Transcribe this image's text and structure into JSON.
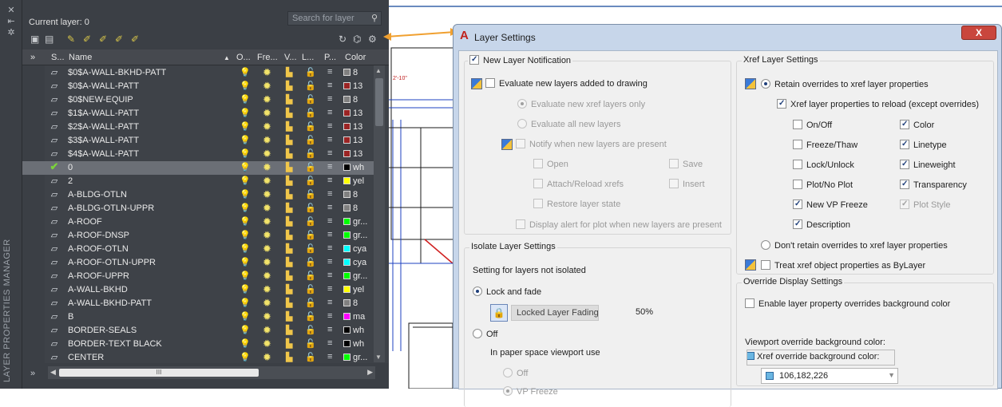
{
  "palette": {
    "vertical_title": "LAYER PROPERTIES MANAGER",
    "current_layer": "Current layer: 0",
    "search_placeholder": "Search for layer",
    "columns": {
      "status": "S...",
      "name": "Name",
      "on": "O...",
      "freeze": "Fre...",
      "vp": "V...",
      "lock": "L...",
      "plot": "P...",
      "color": "Color"
    },
    "layers": [
      {
        "name": "$0$A-WALL-BKHD-PATT",
        "color": "#808080",
        "color_name": "8",
        "current": false
      },
      {
        "name": "$0$A-WALL-PATT",
        "color": "#9b2424",
        "color_name": "13",
        "current": false
      },
      {
        "name": "$0$NEW-EQUIP",
        "color": "#808080",
        "color_name": "8",
        "current": false
      },
      {
        "name": "$1$A-WALL-PATT",
        "color": "#9b2424",
        "color_name": "13",
        "current": false
      },
      {
        "name": "$2$A-WALL-PATT",
        "color": "#9b2424",
        "color_name": "13",
        "current": false
      },
      {
        "name": "$3$A-WALL-PATT",
        "color": "#9b2424",
        "color_name": "13",
        "current": false
      },
      {
        "name": "$4$A-WALL-PATT",
        "color": "#9b2424",
        "color_name": "13",
        "current": false
      },
      {
        "name": "0",
        "color": "#000000",
        "color_name": "wh",
        "current": true
      },
      {
        "name": "2",
        "color": "#ffff00",
        "color_name": "yel",
        "current": false
      },
      {
        "name": "A-BLDG-OTLN",
        "color": "#808080",
        "color_name": "8",
        "current": false
      },
      {
        "name": "A-BLDG-OTLN-UPPR",
        "color": "#808080",
        "color_name": "8",
        "current": false
      },
      {
        "name": "A-ROOF",
        "color": "#00ff00",
        "color_name": "gr...",
        "current": false
      },
      {
        "name": "A-ROOF-DNSP",
        "color": "#00ff00",
        "color_name": "gr...",
        "current": false
      },
      {
        "name": "A-ROOF-OTLN",
        "color": "#00ffff",
        "color_name": "cya",
        "current": false
      },
      {
        "name": "A-ROOF-OTLN-UPPR",
        "color": "#00ffff",
        "color_name": "cya",
        "current": false
      },
      {
        "name": "A-ROOF-UPPR",
        "color": "#00ff00",
        "color_name": "gr...",
        "current": false
      },
      {
        "name": "A-WALL-BKHD",
        "color": "#ffff00",
        "color_name": "yel",
        "current": false
      },
      {
        "name": "A-WALL-BKHD-PATT",
        "color": "#808080",
        "color_name": "8",
        "current": false
      },
      {
        "name": "B",
        "color": "#ff00ff",
        "color_name": "ma",
        "current": false
      },
      {
        "name": "BORDER-SEALS",
        "color": "#000000",
        "color_name": "wh",
        "current": false
      },
      {
        "name": "BORDER-TEXT BLACK",
        "color": "#000000",
        "color_name": "wh",
        "current": false
      },
      {
        "name": "CENTER",
        "color": "#00ff00",
        "color_name": "gr...",
        "current": false
      }
    ],
    "hscroll_grip": "III"
  },
  "dialog": {
    "title": "Layer Settings",
    "close_label": "X",
    "new_layer": {
      "group_label": "New Layer Notification",
      "evaluate_label": "Evaluate new layers added to drawing",
      "evaluate_xref_only": "Evaluate new xref layers only",
      "evaluate_all": "Evaluate all new layers",
      "notify_label": "Notify when new layers are present",
      "open": "Open",
      "save": "Save",
      "attach_reload": "Attach/Reload xrefs",
      "insert": "Insert",
      "restore_state": "Restore layer state",
      "display_alert": "Display alert for plot when new layers are present"
    },
    "isolate": {
      "group_label": "Isolate Layer Settings",
      "setting_label": "Setting for layers not isolated",
      "lock_fade": "Lock and fade",
      "locked_fading_label": "Locked Layer Fading",
      "locked_fading_value": "50%",
      "off": "Off",
      "paper_space_label": "In paper space viewport use",
      "ps_off": "Off",
      "vp_freeze": "VP Freeze"
    },
    "xref": {
      "group_label": "Xref Layer Settings",
      "retain": "Retain overrides to xref layer properties",
      "reload_label": "Xref layer properties to reload (except overrides)",
      "on_off": "On/Off",
      "color": "Color",
      "freeze_thaw": "Freeze/Thaw",
      "linetype": "Linetype",
      "lock_unlock": "Lock/Unlock",
      "lineweight": "Lineweight",
      "plot_noplot": "Plot/No Plot",
      "transparency": "Transparency",
      "new_vp_freeze": "New VP Freeze",
      "plot_style": "Plot Style",
      "description": "Description",
      "dont_retain": "Don't retain overrides to xref layer properties",
      "treat_bylayer": "Treat xref object properties as ByLayer"
    },
    "override": {
      "group_label": "Override Display Settings",
      "enable_label": "Enable layer property overrides background color",
      "viewport_bg_label": "Viewport override background color:",
      "xref_bg_label": "Xref override background color:",
      "xref_bg_value": "106,182,226"
    }
  },
  "colors": {
    "palette_bg": "#3b3f45",
    "accent_arrow": "#f0a030",
    "dialog_frame": "#c7d6ea"
  }
}
